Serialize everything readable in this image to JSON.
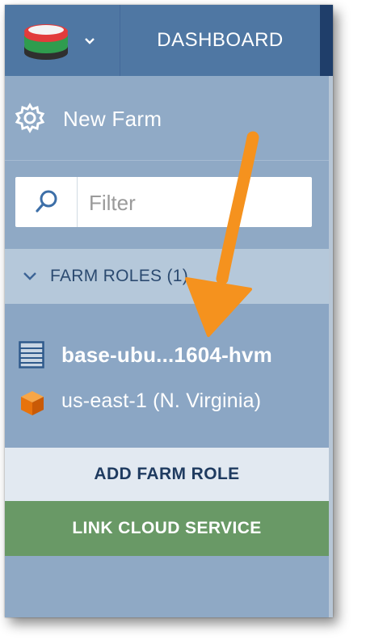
{
  "topbar": {
    "logo_icon": "stacked-layers-logo-icon",
    "dropdown_icon": "chevron-down-icon",
    "dashboard_label": "DASHBOARD"
  },
  "sidebar": {
    "new_farm_icon": "gear-icon",
    "new_farm_label": "New Farm",
    "filter": {
      "icon": "search-icon",
      "placeholder": "Filter",
      "value": ""
    },
    "farm_roles": {
      "toggle_icon": "chevron-down-icon",
      "header_label": "FARM ROLES (1)",
      "items": [
        {
          "icon": "server-icon",
          "name": "base-ubu...1604-hvm",
          "region_icon": "orange-cube-icon",
          "region": "us-east-1 (N. Virginia)"
        }
      ]
    },
    "add_farm_role_label": "ADD FARM ROLE",
    "link_cloud_service_label": "LINK CLOUD SERVICE"
  },
  "annotation": {
    "icon": "orange-arrow-icon",
    "color": "#f5921e"
  },
  "colors": {
    "topbar": "#4f77a3",
    "sidebar": "#8fa9c5",
    "roles_header": "#b5c8da",
    "add_role_bg": "#e2e9f1",
    "link_cloud_bg": "#699966",
    "arrow": "#f5921e"
  }
}
